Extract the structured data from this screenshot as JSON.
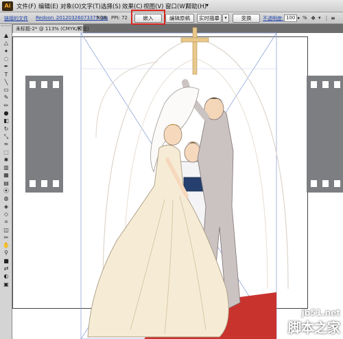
{
  "app": {
    "logo": "Ai"
  },
  "menubar": {
    "items": [
      "文件(F)",
      "编辑(E)",
      "对象(O)",
      "文字(T)",
      "选择(S)",
      "效果(C)",
      "视图(V)",
      "窗口(W)",
      "帮助(H)"
    ]
  },
  "controlbar": {
    "linked_file_label": "链接的文件",
    "filename": "Redoon_20120326073375.jpg",
    "color_mode": "RGB",
    "ppi": "PPI: 72",
    "embed_button": "嵌入",
    "edit_original_button": "编辑原稿",
    "live_trace_button": "实时描摹",
    "transform_button": "变换",
    "opacity_label": "不透明度:",
    "opacity_value": "100",
    "opacity_unit": "%"
  },
  "document": {
    "tab_title": "未标题-2* @ 113% (CMYK/预览)"
  },
  "tools": [
    "selection-icon",
    "direct-selection-icon",
    "magic-wand-icon",
    "lasso-icon",
    "pen-icon",
    "type-icon",
    "line-icon",
    "rectangle-icon",
    "paintbrush-icon",
    "pencil-icon",
    "blob-brush-icon",
    "eraser-icon",
    "rotate-icon",
    "scale-icon",
    "warp-icon",
    "free-transform-icon",
    "symbol-sprayer-icon",
    "graph-icon",
    "mesh-icon",
    "gradient-icon",
    "eyedropper-icon",
    "blend-icon",
    "live-paint-icon",
    "live-paint-select-icon",
    "crop-icon",
    "slice-icon",
    "scissors-icon",
    "hand-icon",
    "zoom-icon",
    "fill-stroke-icon",
    "swap-icon",
    "color-mode-icon",
    "screen-mode-icon"
  ],
  "watermark": {
    "url": "jb51.net",
    "name": "脚本之家"
  },
  "colors": {
    "highlight": "#d7261f",
    "carpet": "#c9332e",
    "dress": "#f6ecd6",
    "suit": "#c8c0c0"
  }
}
